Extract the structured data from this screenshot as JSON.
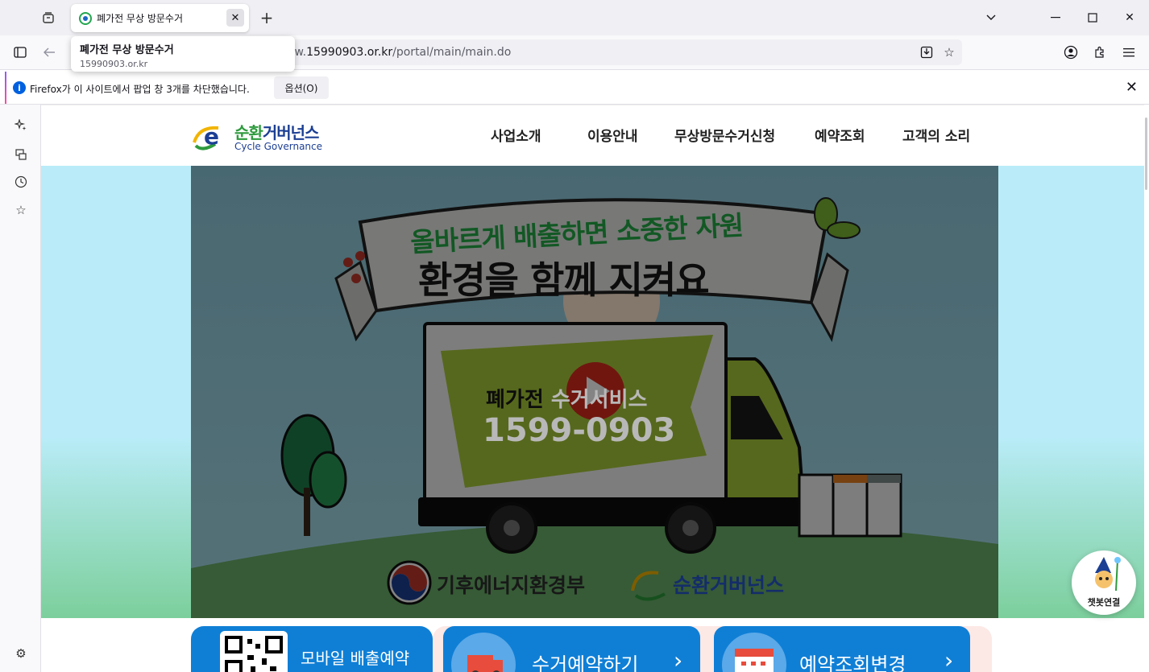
{
  "browser": {
    "tab_title": "폐가전 무상 방문수거",
    "tooltip_title": "폐가전 무상 방문수거",
    "tooltip_domain": "15990903.or.kr",
    "url_prefix": "ww.",
    "url_domain": "15990903.or.kr",
    "url_path": "/portal/main/main.do",
    "notice_message": "Firefox가 이 사이트에서 팝업 창 3개를 차단했습니다.",
    "notice_option_label": "옵션(O)"
  },
  "site": {
    "logo_ko_a": "순환",
    "logo_ko_b": "거버넌스",
    "logo_en": "Cycle Governance",
    "menu": [
      "사업소개",
      "이용안내",
      "무상방문수거신청",
      "예약조회",
      "고객의 소리"
    ]
  },
  "video": {
    "banner_line1": "올바르게 배출하면 소중한 자원",
    "banner_line2": "환경을 함께 지켜요",
    "truck_title_a": "폐가전 ",
    "truck_title_b": "수거서비스",
    "truck_phone": "1599-0903",
    "org1": "기후에너지환경부",
    "org2_a": "순환",
    "org2_b": "거버넌스"
  },
  "chatbot_label": "챗봇연결",
  "quick_links": {
    "mobile": "모바일 배출예약",
    "reserve": "수거예약하기",
    "lookup": "예약조회변경"
  },
  "colors": {
    "brand_blue": "#1c3f94",
    "brand_green": "#2e9a3d",
    "quick_blue": "#0f7fd6",
    "firefox_blue": "#0060df"
  }
}
